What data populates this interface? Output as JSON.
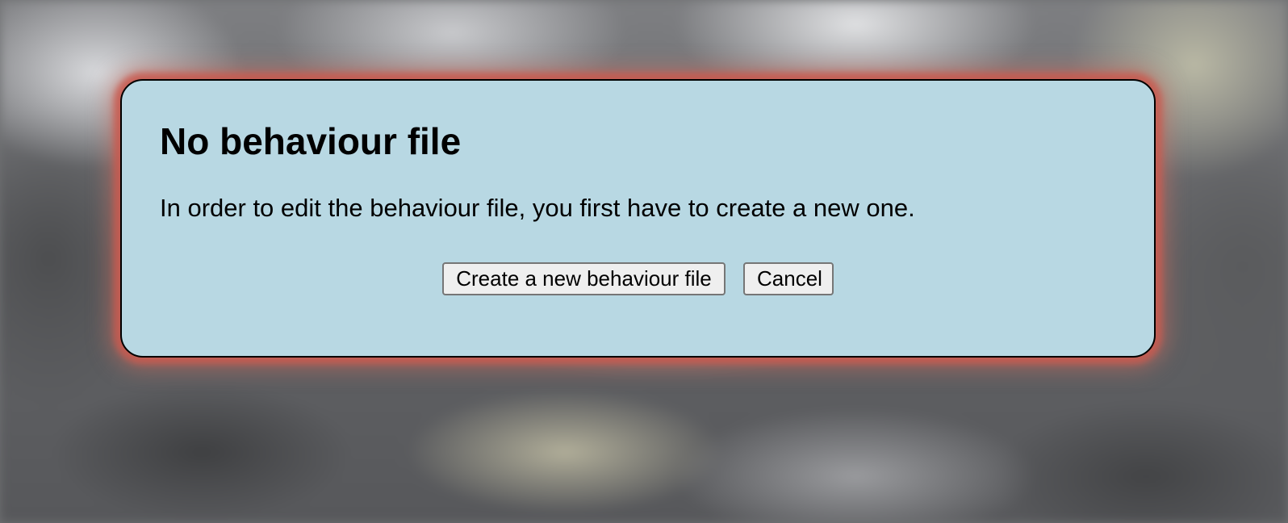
{
  "dialog": {
    "title": "No behaviour file",
    "message": "In order to edit the behaviour file, you first have to create a new one.",
    "buttons": {
      "create_label": "Create a new behaviour file",
      "cancel_label": "Cancel"
    }
  },
  "colors": {
    "dialog_background": "#b8d8e3",
    "dialog_border": "#000000",
    "dialog_glow": "#c85a50",
    "button_background": "#efefef",
    "button_border": "#767676"
  }
}
